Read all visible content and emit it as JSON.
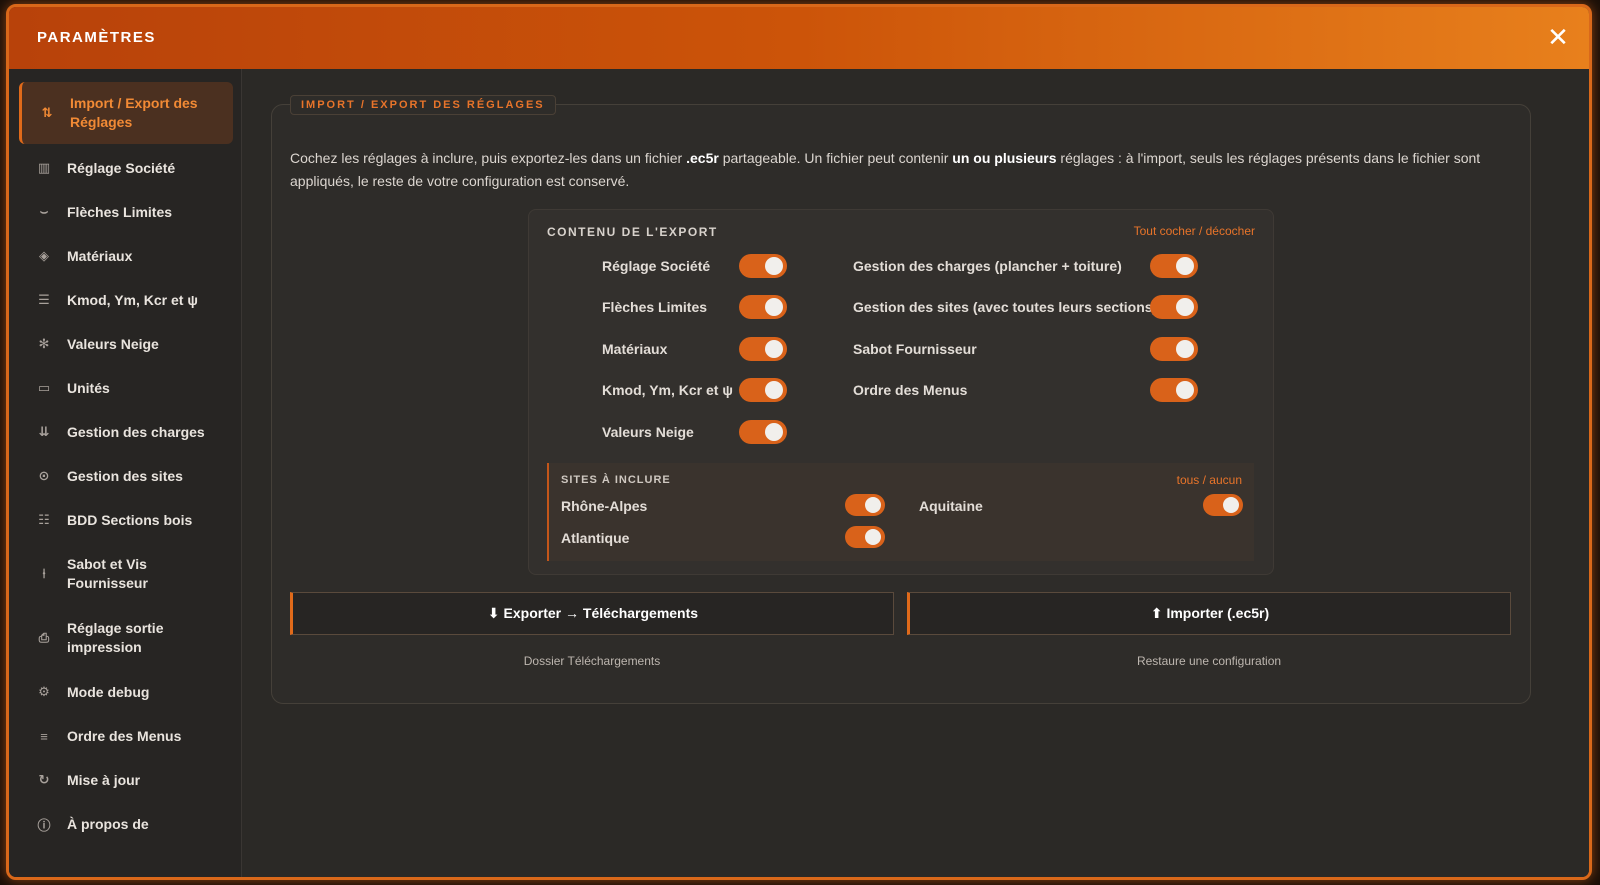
{
  "window": {
    "title": "PARAMÈTRES",
    "close_glyph": "✕"
  },
  "sidebar": {
    "items": [
      {
        "label": "Import / Export des Réglages",
        "icon": "import-export-icon",
        "glyph": "⇅"
      },
      {
        "label": "Réglage Société",
        "icon": "building-icon",
        "glyph": "▥"
      },
      {
        "label": "Flèches Limites",
        "icon": "deflection-icon",
        "glyph": "⌣"
      },
      {
        "label": "Matériaux",
        "icon": "layers-icon",
        "glyph": "◈"
      },
      {
        "label": "Kmod, Ym, Kcr et ψ",
        "icon": "sliders-icon",
        "glyph": "☰"
      },
      {
        "label": "Valeurs Neige",
        "icon": "snowflake-icon",
        "glyph": "✻"
      },
      {
        "label": "Unités",
        "icon": "ruler-icon",
        "glyph": "▭"
      },
      {
        "label": "Gestion des charges",
        "icon": "load-icon",
        "glyph": "⇊"
      },
      {
        "label": "Gestion des sites",
        "icon": "map-pin-icon",
        "glyph": "⊙"
      },
      {
        "label": "BDD Sections bois",
        "icon": "database-icon",
        "glyph": "☷"
      },
      {
        "label": "Sabot et Vis Fournisseur",
        "icon": "screw-icon",
        "glyph": "⍿"
      },
      {
        "label": "Réglage sortie impression",
        "icon": "printer-icon",
        "glyph": "⎙"
      },
      {
        "label": "Mode debug",
        "icon": "bug-icon",
        "glyph": "⚙"
      },
      {
        "label": "Ordre des Menus",
        "icon": "list-order-icon",
        "glyph": "≡"
      },
      {
        "label": "Mise à jour",
        "icon": "refresh-icon",
        "glyph": "↻"
      },
      {
        "label": "À propos de",
        "icon": "info-icon",
        "glyph": "ⓘ"
      }
    ]
  },
  "section": {
    "legend": "IMPORT / EXPORT DES RÉGLAGES",
    "desc_1": "Cochez les réglages à inclure, puis exportez-les dans un fichier ",
    "desc_file_ext": ".ec5r",
    "desc_2": " partageable. Un fichier peut contenir ",
    "desc_bold": "un ou plusieurs",
    "desc_3": " réglages : à l'import, seuls les réglages présents dans le fichier sont appliqués, le reste de votre configuration est conservé."
  },
  "export_box": {
    "title": "CONTENU DE L'EXPORT",
    "toggle_all_label": "Tout cocher / décocher",
    "left_options": [
      {
        "label": "Réglage Société",
        "checked": true
      },
      {
        "label": "Flèches Limites",
        "checked": true
      },
      {
        "label": "Matériaux",
        "checked": true
      },
      {
        "label": "Kmod, Ym, Kcr et ψ",
        "checked": true
      },
      {
        "label": "Valeurs Neige",
        "checked": true
      }
    ],
    "right_options": [
      {
        "label": "Gestion des charges (plancher + toiture)",
        "checked": true
      },
      {
        "label": "Gestion des sites (avec toutes leurs sections)",
        "checked": true
      },
      {
        "label": "Sabot Fournisseur",
        "checked": true
      },
      {
        "label": "Ordre des Menus",
        "checked": true
      }
    ]
  },
  "sites": {
    "title": "SITES À INCLURE",
    "all_none_label": "tous / aucun",
    "items": [
      {
        "label": "Rhône-Alpes",
        "checked": true
      },
      {
        "label": "Aquitaine",
        "checked": true
      },
      {
        "label": "Atlantique",
        "checked": true
      }
    ]
  },
  "actions": {
    "export_label": "⬇ Exporter → Téléchargements",
    "export_sub": "Dossier Téléchargements",
    "import_label": "⬆ Importer (.ec5r)",
    "import_sub": "Restaure une configuration"
  },
  "colors": {
    "accent": "#e06a1a",
    "title_gradient_start": "#b8420a",
    "title_gradient_end": "#e8801c",
    "toggle_on": "#d9621a",
    "background": "#2b2926"
  }
}
